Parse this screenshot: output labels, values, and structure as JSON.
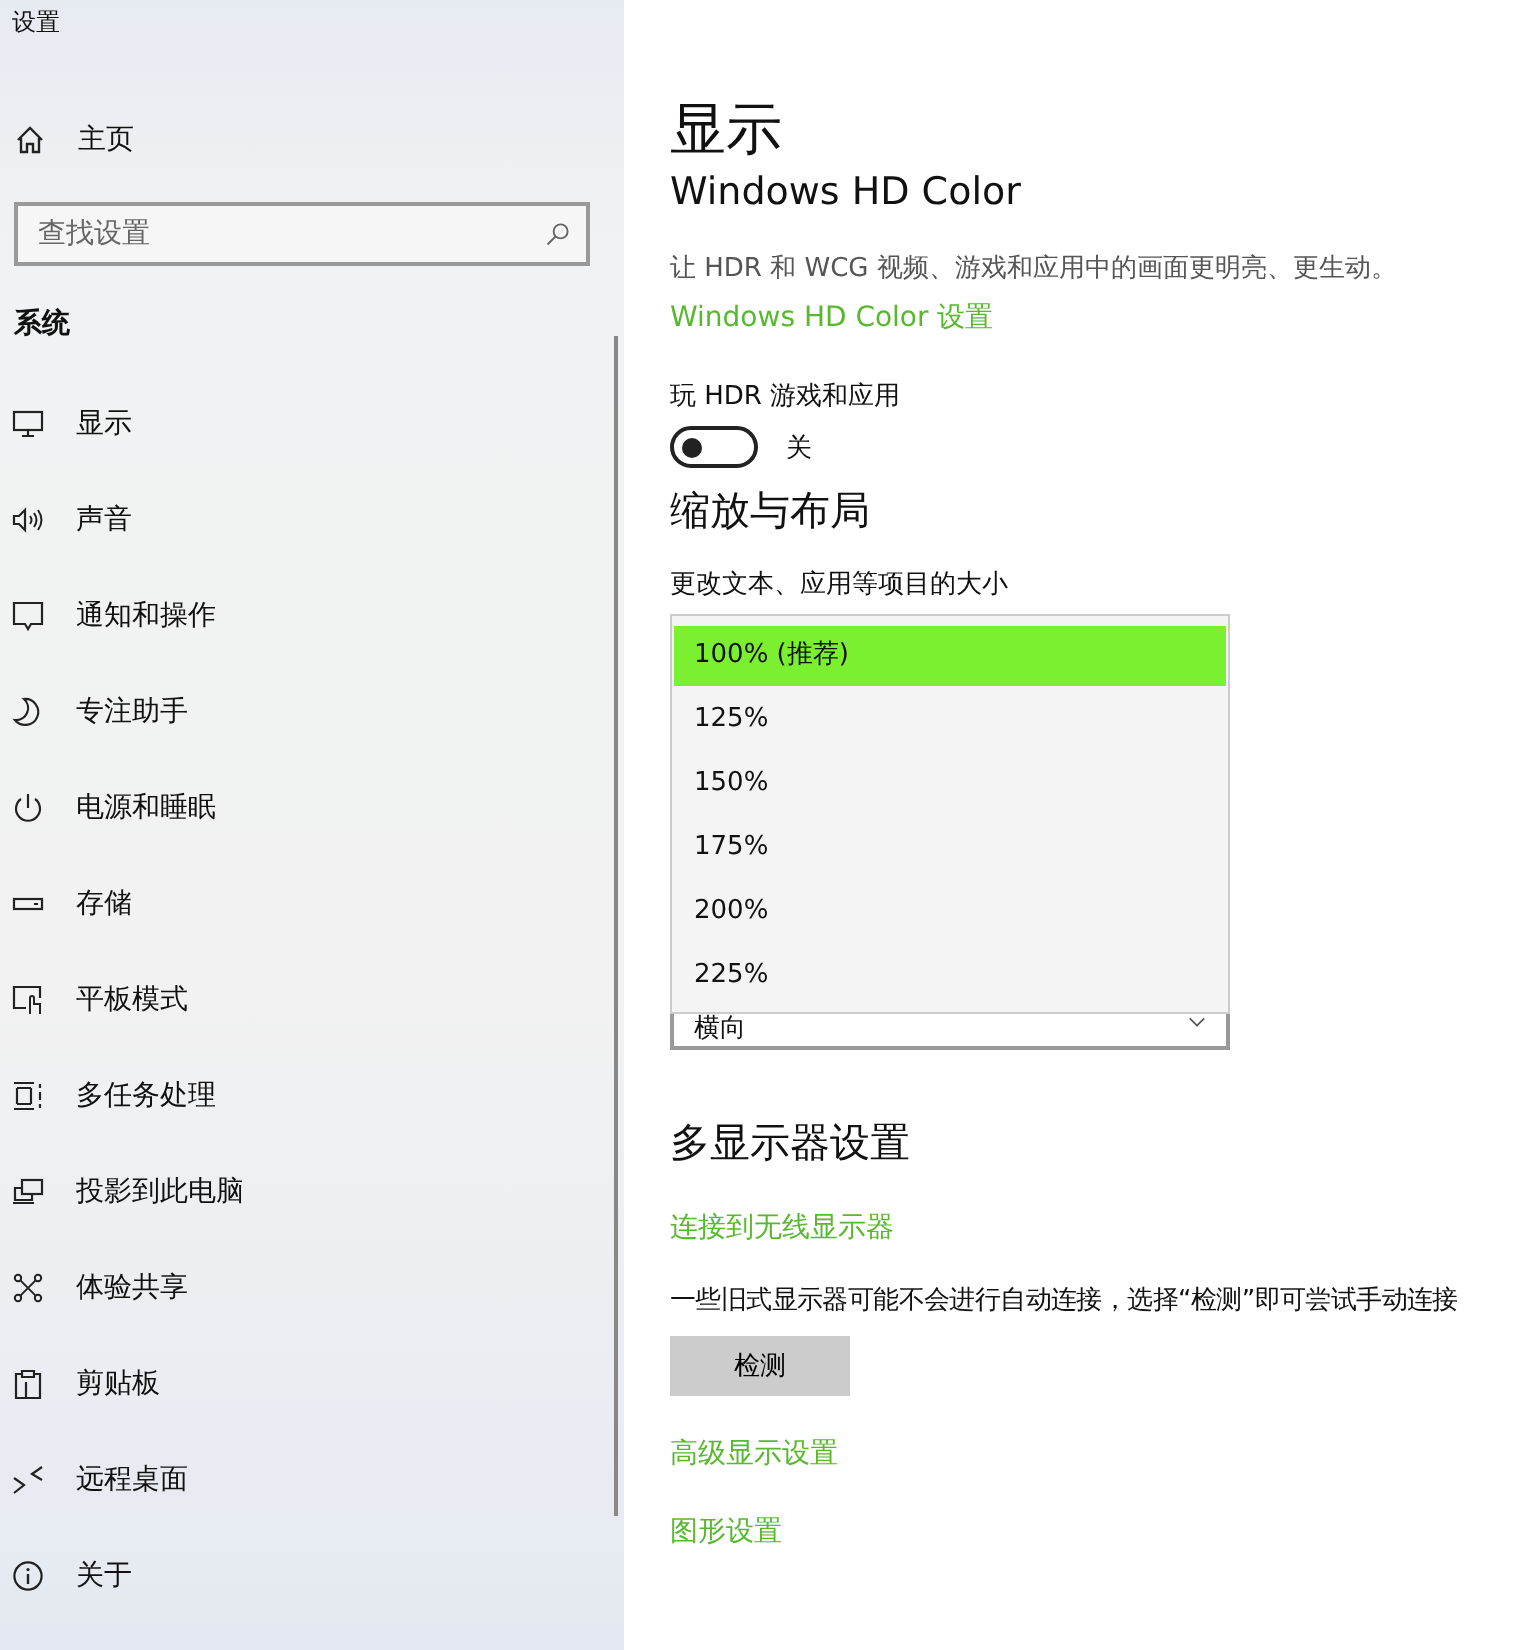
{
  "window": {
    "title": "设置"
  },
  "sidebar": {
    "home": "主页",
    "search": {
      "placeholder": "查找设置"
    },
    "section": "系统",
    "items": [
      {
        "label": "显示",
        "kind": "monitor"
      },
      {
        "label": "声音",
        "kind": "speaker"
      },
      {
        "label": "通知和操作",
        "kind": "message"
      },
      {
        "label": "专注助手",
        "kind": "moon"
      },
      {
        "label": "电源和睡眠",
        "kind": "power"
      },
      {
        "label": "存储",
        "kind": "storage"
      },
      {
        "label": "平板模式",
        "kind": "tablet"
      },
      {
        "label": "多任务处理",
        "kind": "multitask"
      },
      {
        "label": "投影到此电脑",
        "kind": "project"
      },
      {
        "label": "体验共享",
        "kind": "share"
      },
      {
        "label": "剪贴板",
        "kind": "clipboard"
      },
      {
        "label": "远程桌面",
        "kind": "remote"
      },
      {
        "label": "关于",
        "kind": "info"
      }
    ]
  },
  "main": {
    "title": "显示",
    "subtitle": "Windows HD Color",
    "description": "让 HDR 和 WCG 视频、游戏和应用中的画面更明亮、更生动。",
    "link": "Windows HD Color 设置",
    "hdr": {
      "label": "玩 HDR 游戏和应用",
      "on": false,
      "state_text": "关"
    },
    "scale": {
      "heading": "缩放与布局",
      "label": "更改文本、应用等项目的大小",
      "options": [
        {
          "label": "100% (推荐)",
          "selected": true
        },
        {
          "label": "125%",
          "selected": false
        },
        {
          "label": "150%",
          "selected": false
        },
        {
          "label": "175%",
          "selected": false
        },
        {
          "label": "200%",
          "selected": false
        },
        {
          "label": "225%",
          "selected": false
        }
      ],
      "orientation_value": "横向"
    },
    "multi": {
      "heading": "多显示器设置",
      "link": "连接到无线显示器",
      "note": "一些旧式显示器可能不会进行自动连接，选择“检测”即可尝试手动连接",
      "button": "检测",
      "links": [
        "高级显示设置",
        "图形设置"
      ]
    }
  }
}
